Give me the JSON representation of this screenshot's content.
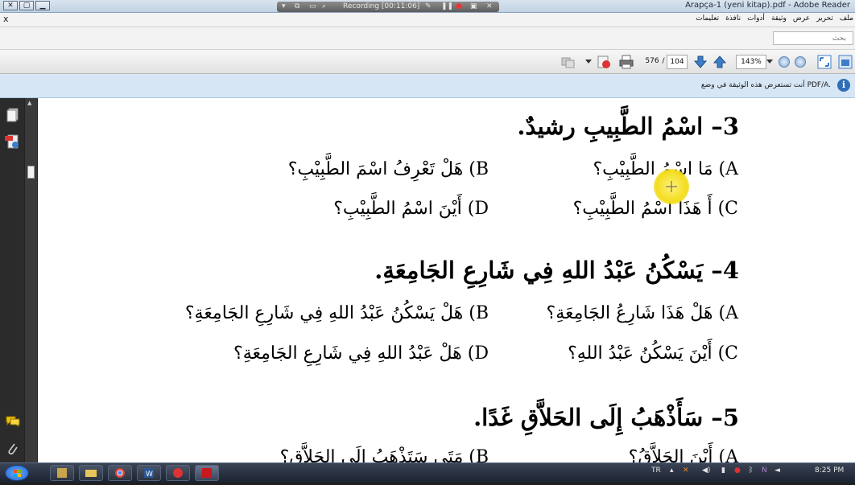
{
  "window": {
    "title": "Arapça-1 (yeni kitap).pdf - Adobe Reader"
  },
  "recording": {
    "label": "Recording [00:11:06]"
  },
  "menu": {
    "close_glyph": "x",
    "items": [
      "ملف",
      "تحرير",
      "عرض",
      "وثيقة",
      "أدوات",
      "نافذة",
      "تعليمات"
    ]
  },
  "search": {
    "placeholder": "بحث"
  },
  "toolbar": {
    "page_current": "576",
    "page_separator": "/",
    "page_total": "104",
    "zoom": "143%"
  },
  "infobar": {
    "message": "أنت تستعرض هذه الوثيقة في وضع PDF/A."
  },
  "document": {
    "questions": [
      {
        "title": "3– اسْمُ الطَّبِيبِ رشيدٌ.",
        "options": {
          "A": "A) مَا اسْمُ الطَّبِيْبِ؟",
          "B": "B) هَلْ تَعْرِفُ اسْمَ الطَّبِيْبِ؟",
          "C": "C) أَ هَذَا اسْمُ الطَّبِيْبِ؟",
          "D": "D) أَيْنَ اسْمُ الطَّبِيْبِ؟"
        }
      },
      {
        "title": "4– يَسْكُنُ عَبْدُ اللهِ فِي شَارِعِ الجَامِعَةِ.",
        "options": {
          "A": "A) هَلْ هَذَا شَارِعُ الجَامِعَةِ؟",
          "B": "B) هَلْ يَسْكُنُ عَبْدُ اللهِ فِي شَارِعِ الجَامِعَةِ؟",
          "C": "C) أَيْنَ يَسْكُنُ عَبْدُ اللهِ؟",
          "D": "D) هَلْ عَبْدُ اللهِ فِي شَارِعِ الجَامِعَةِ؟"
        }
      },
      {
        "title": "5– سَأَذْهَبُ إِلَى الحَلاَّقِ غَدًا.",
        "options": {
          "A": "A) أَيْنَ الحَلاَّقُ؟",
          "B": "B) مَتَى سَتَذْهَبُ إِلَى الحَلاَّقِ؟"
        }
      }
    ]
  },
  "taskbar": {
    "language": "TR",
    "time": "8:25 PM"
  },
  "colors": {
    "infobar_bg": "#d6e6f5",
    "taskbar_bg": "#1b2230",
    "highlight": "#f3dd1f"
  }
}
